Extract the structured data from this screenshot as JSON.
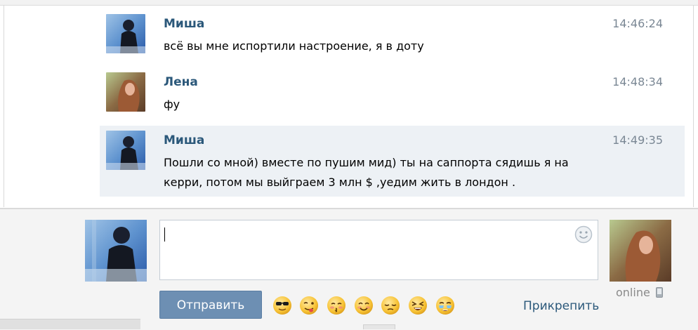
{
  "messages": [
    {
      "author": "Миша",
      "time": "14:46:24",
      "text": "всё вы мне испортили настроение, я в доту",
      "avatar": "misha-avatar"
    },
    {
      "author": "Лена",
      "time": "14:48:34",
      "text": "фу",
      "avatar": "lena-avatar"
    },
    {
      "author": "Миша",
      "time": "14:49:35",
      "text": "Пошли со мной) вместе по пушим мид) ты на саппорта сядишь я на\nкерри, потом мы выйграем 3 млн $ ,уедим жить в лондон .",
      "avatar": "misha-avatar",
      "highlighted": true
    }
  ],
  "composer": {
    "input_value": "",
    "send_label": "Отправить",
    "attach_label": "Прикрепить",
    "peer_status": "online",
    "emoji": [
      "cool-sunglasses-emoji",
      "wink-tongue-emoji",
      "kiss-emoji",
      "smile-emoji",
      "pensive-emoji",
      "laughing-emoji",
      "tearful-emoji"
    ]
  },
  "colors": {
    "author": "#2b587a",
    "time": "#7a8794",
    "highlight_bg": "#edf1f5",
    "send_button": "#6d8fb3",
    "link": "#2b587a"
  }
}
